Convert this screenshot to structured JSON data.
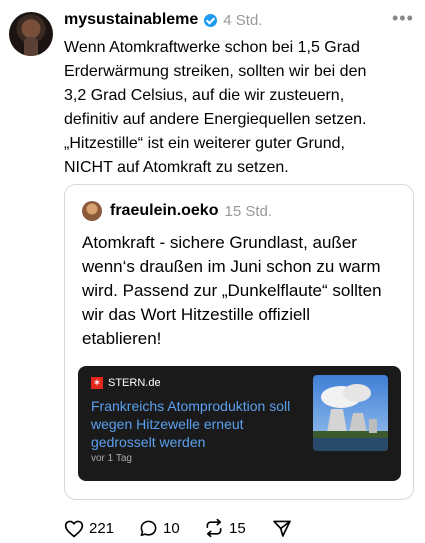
{
  "post": {
    "username": "mysustainableme",
    "time": "4 Std.",
    "text": "Wenn Atomkraftwerke schon bei 1,5 Grad\nErderwärmung streiken, sollten wir bei den\n3,2 Grad Celsius, auf die wir zusteuern,\ndefinitiv auf andere Energiequellen setzen.\n„Hitzestille“ ist ein weiterer guter Grund,\nNICHT auf Atomkraft zu setzen."
  },
  "quote": {
    "username": "fraeulein.oeko",
    "time": "15 Std.",
    "text": "Atomkraft - sichere Grundlast, außer\nwenn‘s draußen im Juni schon zu warm\nwird. Passend zur „Dunkelflaute“ sollten\nwir das Wort Hitzestille offiziell\netablieren!"
  },
  "link": {
    "source": "STERN.de",
    "title": "Frankreichs Atomproduktion soll\nwegen Hitzewelle erneut\ngedrosselt werden",
    "date": "vor 1 Tag"
  },
  "actions": {
    "likes": "221",
    "replies": "10",
    "reposts": "15"
  },
  "icons": {
    "verified": "verified-badge-icon",
    "more": "more-options-icon",
    "like": "heart-icon",
    "reply": "comment-icon",
    "repost": "repost-icon",
    "share": "send-icon"
  },
  "colors": {
    "verified": "#1d9bf0",
    "link_title": "#5aa0ee",
    "link_card_bg": "#1a1a1a",
    "stern_red": "#e3261c"
  }
}
